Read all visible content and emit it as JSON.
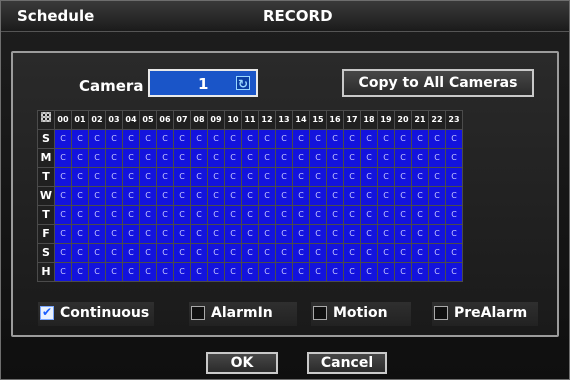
{
  "window": {
    "left_title": "Schedule",
    "center_title": "RECORD"
  },
  "camera": {
    "label": "Camera",
    "value": "1",
    "icon": "refresh-icon"
  },
  "buttons": {
    "copy": "Copy to All Cameras",
    "ok": "OK",
    "cancel": "Cancel"
  },
  "grid": {
    "hours": [
      "00",
      "01",
      "02",
      "03",
      "04",
      "05",
      "06",
      "07",
      "08",
      "09",
      "10",
      "11",
      "12",
      "13",
      "14",
      "15",
      "16",
      "17",
      "18",
      "19",
      "20",
      "21",
      "22",
      "23"
    ],
    "days": [
      "S",
      "M",
      "T",
      "W",
      "T",
      "F",
      "S",
      "H"
    ],
    "cell_value": "C"
  },
  "legend": [
    {
      "label": "Continuous",
      "checked": true
    },
    {
      "label": "AlarmIn",
      "checked": false
    },
    {
      "label": "Motion",
      "checked": false
    },
    {
      "label": "PreAlarm",
      "checked": false
    }
  ],
  "colors": {
    "cell": "#1313dd",
    "panel_border": "#9c9c9c"
  }
}
